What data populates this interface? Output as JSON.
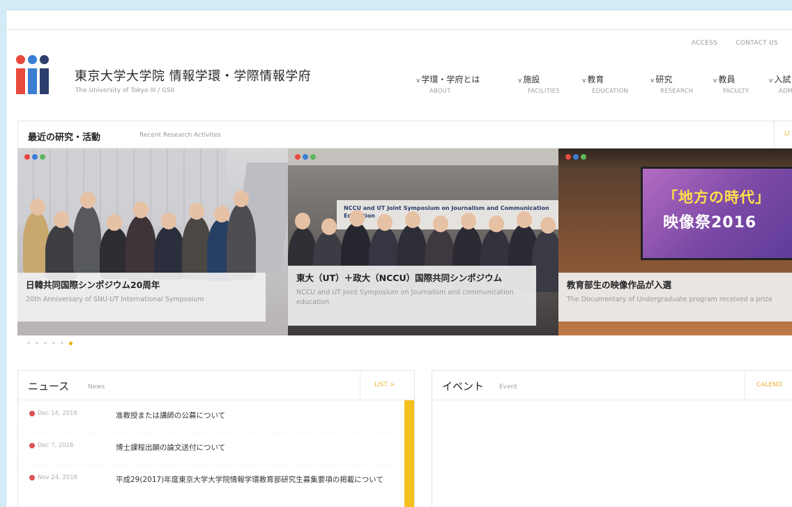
{
  "utility_nav": {
    "access": "ACCESS",
    "contact": "CONTACT US"
  },
  "header": {
    "title": "東京大学大学院 情報学環・学際情報学府",
    "subtitle": "The University of Tokyo III / GSII"
  },
  "logo_colors": {
    "red": "#e84a3d",
    "blue": "#3a7fd4",
    "navy": "#2c3e6b"
  },
  "global_nav": [
    {
      "jp": "学環・学府とは",
      "en": "ABOUT"
    },
    {
      "jp": "施設",
      "en": "FACILITIES"
    },
    {
      "jp": "教育",
      "en": "EDUCATION"
    },
    {
      "jp": "研究",
      "en": "RESEARCH"
    },
    {
      "jp": "教員",
      "en": "FACULTY"
    },
    {
      "jp": "入試",
      "en": "ADM"
    }
  ],
  "recent_research": {
    "title": "最近の研究・活動",
    "subtitle": "Recent Research Activites",
    "list_label": "LI"
  },
  "slides": [
    {
      "title": "日韓共同国際シンポジウム20周年",
      "desc": "20th Anniversary of SNU-UT International Symposium"
    },
    {
      "title": "東大（UT）＋政大（NCCU）国際共同シンポジウム",
      "desc": "NCCU and UT Joint Symposium on Journalism and communication education",
      "banner": "NCCU and UT Joint Symposium on Journalism and Communication Education"
    },
    {
      "title": "教育部生の映像作品が入選",
      "desc": "The Documentary of Undergraduate program received a prize",
      "screen_text_1": "「地方の時代」",
      "screen_text_2": "映像祭2016"
    }
  ],
  "slider_dot_colors": [
    "#e84a3d",
    "#3a7fd4",
    "#5cb85c"
  ],
  "pager": {
    "count": 6,
    "active": 5
  },
  "news": {
    "title": "ニュース",
    "subtitle": "News",
    "list_label": "LIST >",
    "items": [
      {
        "date": "Dec 14, 2016",
        "text": "准教授または講師の公募について"
      },
      {
        "date": "Dec 7, 2016",
        "text": "博士課程出願の論文送付について"
      },
      {
        "date": "Nov 24, 2016",
        "text": "平成29(2017)年度東京大学大学院情報学環教育部研究生募集要項の掲載について"
      }
    ]
  },
  "events": {
    "title": "イベント",
    "subtitle": "Event",
    "calendar_label": "CALEND"
  },
  "accent_color": "#f3c11e"
}
